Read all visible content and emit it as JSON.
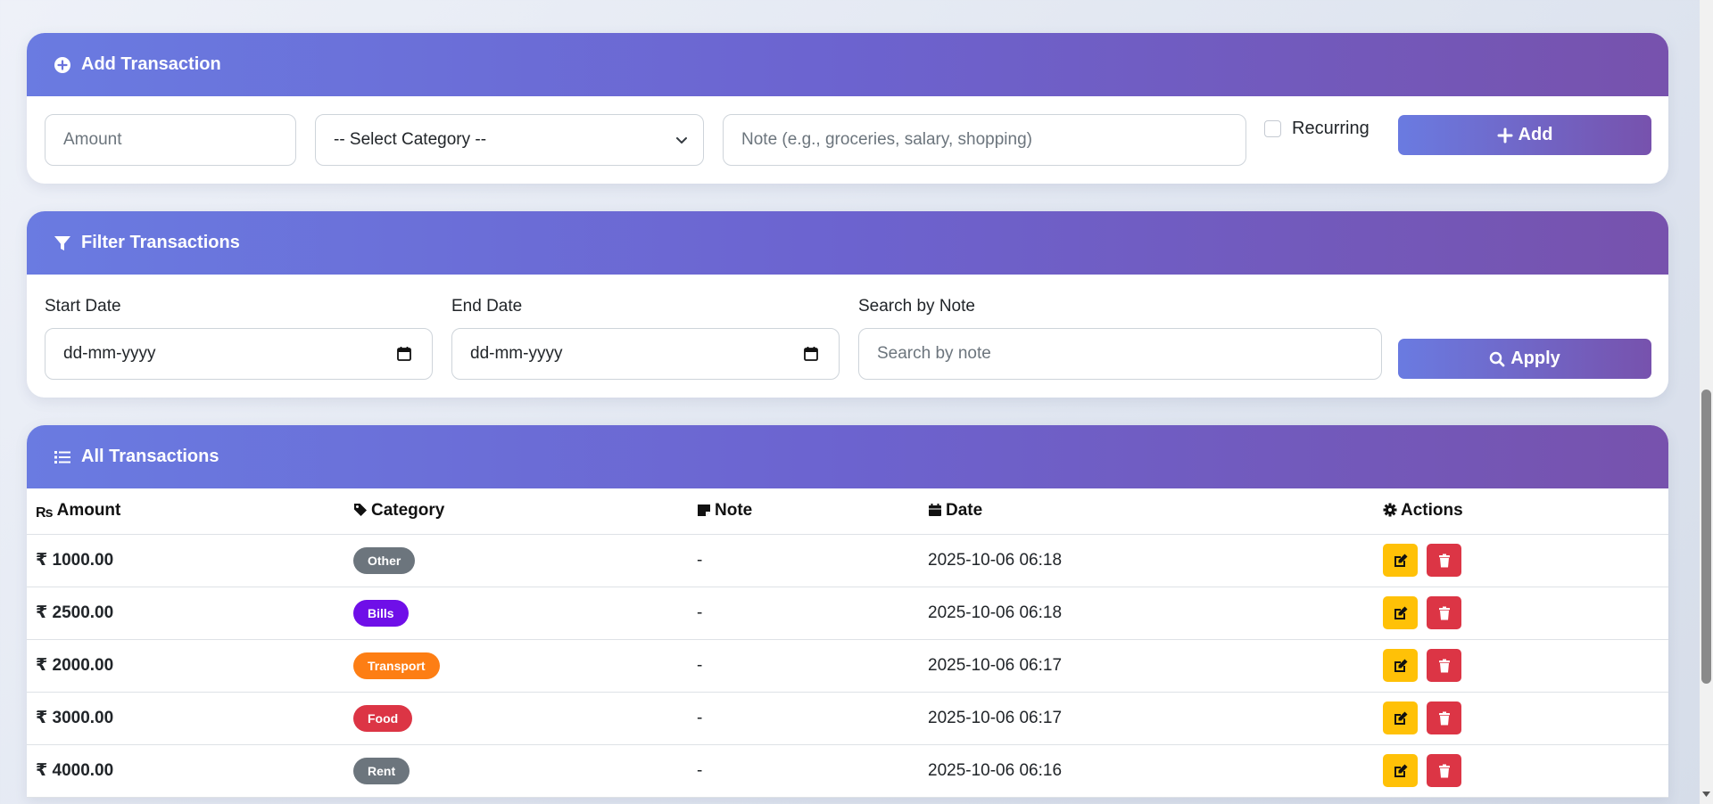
{
  "add_transaction": {
    "title": "Add Transaction",
    "amount_placeholder": "Amount",
    "category_value": "-- Select Category --",
    "note_placeholder": "Note (e.g., groceries, salary, shopping)",
    "recurring_label": "Recurring",
    "add_button": "Add"
  },
  "filter": {
    "title": "Filter Transactions",
    "start_label": "Start Date",
    "end_label": "End Date",
    "search_label": "Search by Note",
    "date_placeholder": "dd-mm-yyyy",
    "search_placeholder": "Search by note",
    "apply_button": "Apply"
  },
  "transactions": {
    "title": "All Transactions",
    "columns": {
      "amount": "Amount",
      "category": "Category",
      "note": "Note",
      "date": "Date",
      "actions": "Actions"
    },
    "rows": [
      {
        "amount": "₹ 1000.00",
        "category": "Other",
        "category_color": "#6c757d",
        "note": "-",
        "date": "2025-10-06 06:18"
      },
      {
        "amount": "₹ 2500.00",
        "category": "Bills",
        "category_color": "#6f0fe8",
        "note": "-",
        "date": "2025-10-06 06:18"
      },
      {
        "amount": "₹ 2000.00",
        "category": "Transport",
        "category_color": "#fd7e14",
        "note": "-",
        "date": "2025-10-06 06:17"
      },
      {
        "amount": "₹ 3000.00",
        "category": "Food",
        "category_color": "#dc3545",
        "note": "-",
        "date": "2025-10-06 06:17"
      },
      {
        "amount": "₹ 4000.00",
        "category": "Rent",
        "category_color": "#6c757d",
        "note": "-",
        "date": "2025-10-06 06:16"
      }
    ]
  },
  "colors": {
    "header_gradient_start": "#6a7be1",
    "header_gradient_end": "#7752ad",
    "edit": "#ffc107",
    "delete": "#dc3545"
  },
  "icons": [
    "plus-circle-icon",
    "filter-icon",
    "list-icon",
    "rupee-icon",
    "tag-icon",
    "sticky-note-icon",
    "calendar-icon",
    "gear-icon",
    "plus-icon",
    "search-icon",
    "edit-icon",
    "trash-icon",
    "chevron-down-icon"
  ]
}
